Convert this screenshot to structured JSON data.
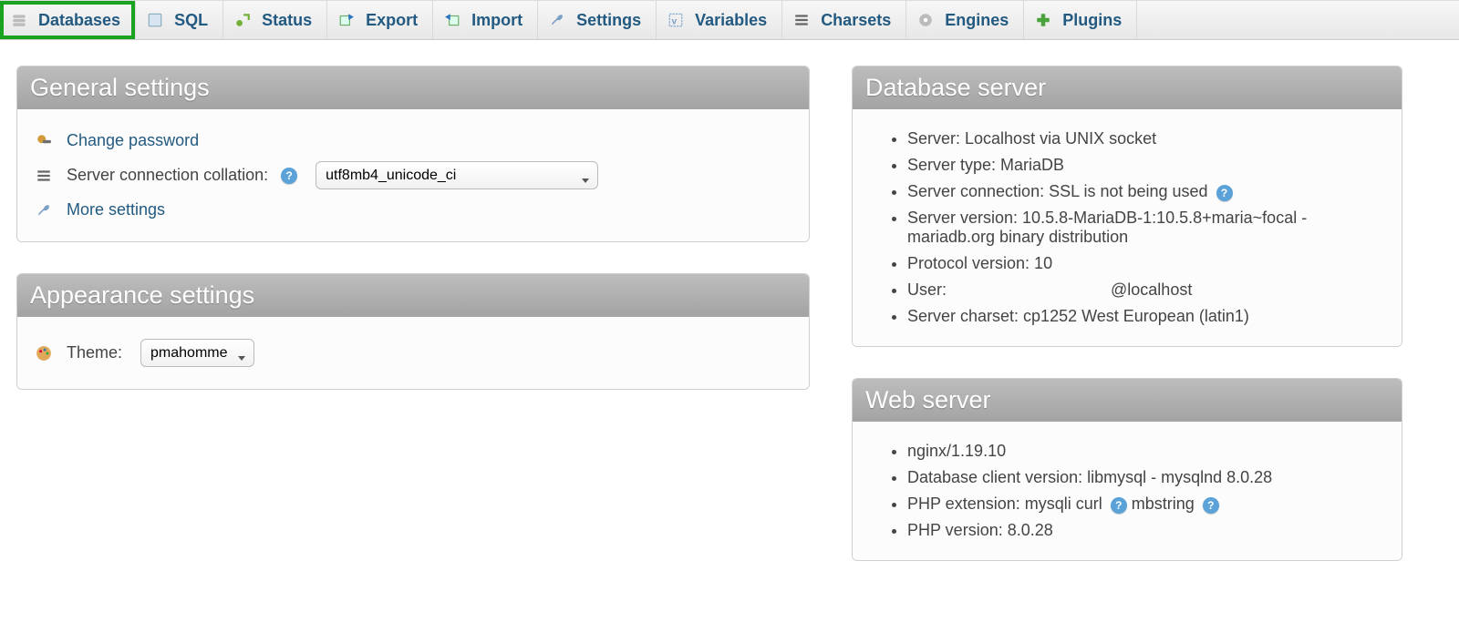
{
  "tabs": [
    {
      "label": "Databases",
      "icon": "db-icon",
      "highlight": true
    },
    {
      "label": "SQL",
      "icon": "sql-icon",
      "highlight": false
    },
    {
      "label": "Status",
      "icon": "status-icon",
      "highlight": false
    },
    {
      "label": "Export",
      "icon": "export-icon",
      "highlight": false
    },
    {
      "label": "Import",
      "icon": "import-icon",
      "highlight": false
    },
    {
      "label": "Settings",
      "icon": "settings-icon",
      "highlight": false
    },
    {
      "label": "Variables",
      "icon": "variables-icon",
      "highlight": false
    },
    {
      "label": "Charsets",
      "icon": "charsets-icon",
      "highlight": false
    },
    {
      "label": "Engines",
      "icon": "engines-icon",
      "highlight": false
    },
    {
      "label": "Plugins",
      "icon": "plugins-icon",
      "highlight": false
    }
  ],
  "general": {
    "title": "General settings",
    "change_password": "Change password",
    "collation_label": "Server connection collation:",
    "collation_value": "utf8mb4_unicode_ci",
    "more_settings": "More settings"
  },
  "appearance": {
    "title": "Appearance settings",
    "theme_label": "Theme:",
    "theme_value": "pmahomme"
  },
  "db_server": {
    "title": "Database server",
    "items": [
      "Server: Localhost via UNIX socket",
      "Server type: MariaDB",
      "Server connection: SSL is not being used",
      "Server version: 10.5.8-MariaDB-1:10.5.8+maria~focal - mariadb.org binary distribution",
      "Protocol version: 10",
      "User:                                   @localhost",
      "Server charset: cp1252 West European (latin1)"
    ],
    "help_after_index": 2
  },
  "web_server": {
    "title": "Web server",
    "items": [
      "nginx/1.19.10",
      "Database client version: libmysql - mysqlnd 8.0.28",
      "PHP extension: mysqli   curl   mbstring",
      "PHP version: 8.0.28"
    ],
    "ext_help_count_at_index": {
      "2": 3
    }
  }
}
